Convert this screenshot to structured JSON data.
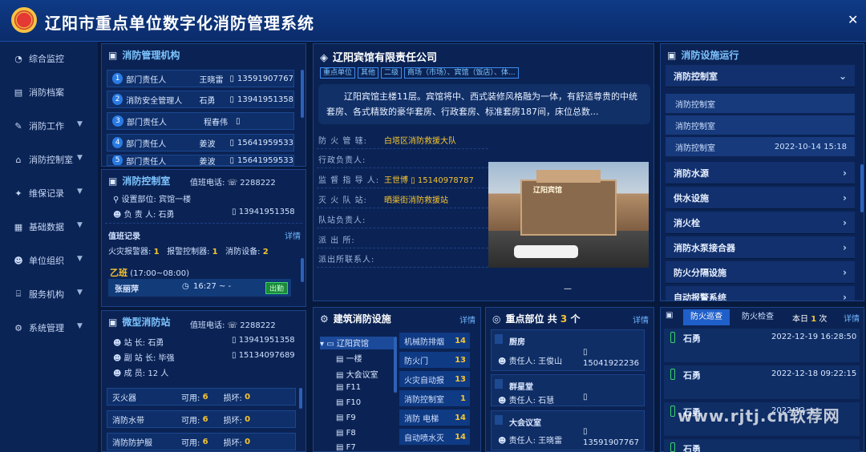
{
  "app": {
    "title": "辽阳市重点单位数字化消防管理系统",
    "close_icon": "close-icon"
  },
  "nav": [
    {
      "label": "综合监控",
      "icon": "dashboard-icon"
    },
    {
      "label": "消防档案",
      "icon": "file-icon"
    },
    {
      "label": "消防工作",
      "icon": "edit-icon"
    },
    {
      "label": "消防控制室",
      "icon": "home-icon"
    },
    {
      "label": "维保记录",
      "icon": "wrench-icon"
    },
    {
      "label": "基础数据",
      "icon": "grid-icon"
    },
    {
      "label": "单位组织",
      "icon": "users-icon"
    },
    {
      "label": "服务机构",
      "icon": "bank-icon"
    },
    {
      "label": "系统管理",
      "icon": "gear-icon"
    }
  ],
  "org": {
    "title": "消防管理机构",
    "rows": [
      {
        "n": "1",
        "role": "部门责任人",
        "name": "王晓雷",
        "phone": "13591907767"
      },
      {
        "n": "2",
        "role": "消防安全管理人",
        "name": "石勇",
        "phone": "13941951358"
      },
      {
        "n": "3",
        "role": "部门责任人",
        "name": "程春伟",
        "phone": ""
      },
      {
        "n": "4",
        "role": "部门责任人",
        "name": "姜波",
        "phone": "15641959533"
      },
      {
        "n": "5",
        "role": "部门责任人",
        "name": "姜波",
        "phone": "15641959533"
      }
    ]
  },
  "control": {
    "title": "消防控制室",
    "duty_label": "值班电话:",
    "duty_phone": "2288222",
    "loc_label": "设置部位:",
    "loc": "宾馆一楼",
    "resp_label": "负 责 人:",
    "resp": "石勇",
    "resp_phone": "13941951358",
    "rec_label": "值班记录",
    "detail": "详情",
    "counts": [
      {
        "label": "火灾报警器:",
        "val": "1"
      },
      {
        "label": "报警控制器:",
        "val": "1"
      },
      {
        "label": "消防设备:",
        "val": "2"
      }
    ],
    "shift": "乙班",
    "shift_time": "(17:00~08:00)",
    "person": "张丽萍",
    "time": "16:27 ~ -",
    "status": "出勤"
  },
  "micro": {
    "title": "微型消防站",
    "duty_label": "值班电话:",
    "duty_phone": "2288222",
    "station_label": "站      长:",
    "station": "石勇",
    "station_phone": "13941951358",
    "vice_label": "副 站 长:",
    "vice": "毕强",
    "vice_phone": "15134097689",
    "member_label": "成      员:",
    "member": "12 人",
    "items": [
      {
        "name": "灭火器",
        "ok_label": "可用:",
        "ok": "6",
        "bad_label": "损坏:",
        "bad": "0"
      },
      {
        "name": "消防水带",
        "ok_label": "可用:",
        "ok": "6",
        "bad_label": "损坏:",
        "bad": "0"
      },
      {
        "name": "消防防护服",
        "ok_label": "可用:",
        "ok": "6",
        "bad_label": "损坏:",
        "bad": "0"
      }
    ]
  },
  "company": {
    "title": "辽阳宾馆有限责任公司",
    "tags": [
      "重点单位",
      "其他",
      "二级",
      "商场（市场）、宾馆（饭店）、体..."
    ],
    "desc": "辽阳宾馆主楼11层。宾馆将中、西式装修风格融为一体，有舒适尊贵的中统套房、各式精致的豪华套房、行政套房、标准套房187间，床位总数...",
    "info": [
      {
        "label": "防 火 管 辖:",
        "val": "白塔区消防救援大队",
        "phone": ""
      },
      {
        "label": "行政负责人:",
        "val": "",
        "phone": ""
      },
      {
        "label": "监 督 指 导 人:",
        "val": "王世博",
        "phone": "15140978787"
      },
      {
        "label": "灭 火 队 站:",
        "val": "晒渠街消防救援站",
        "phone": ""
      },
      {
        "label": "队站负责人:",
        "val": "",
        "phone": ""
      },
      {
        "label": "派      出      所:",
        "val": "",
        "phone": ""
      },
      {
        "label": "派出所联系人:",
        "val": "",
        "phone": ""
      }
    ],
    "photo_label": "辽阳宾馆",
    "pager": "—"
  },
  "facility": {
    "title": "建筑消防设施",
    "detail": "详情",
    "tree": [
      "辽阳宾馆",
      "一楼",
      "大会议室",
      "F11",
      "F10",
      "F9",
      "F8",
      "F7"
    ],
    "items": [
      {
        "name": "机械防排烟",
        "n": "14"
      },
      {
        "name": "防火门",
        "n": "13"
      },
      {
        "name": "火灾自动报",
        "n": "13"
      },
      {
        "name": "消防控制室",
        "n": "1"
      },
      {
        "name": "消防 电梯",
        "n": "14"
      },
      {
        "name": "自动喷水灭",
        "n": "14"
      }
    ]
  },
  "key": {
    "title": "重点部位",
    "count_prefix": "共",
    "count": "3",
    "count_suffix": "个",
    "detail": "详情",
    "items": [
      {
        "name": "厨房",
        "resp_label": "责任人:",
        "resp": "王俊山",
        "phone": "15041922236"
      },
      {
        "name": "群星堂",
        "resp_label": "责任人:",
        "resp": "石慧",
        "phone": ""
      },
      {
        "name": "大会议室",
        "resp_label": "责任人:",
        "resp": "王晓雷",
        "phone": "13591907767"
      }
    ]
  },
  "equip": {
    "title": "消防设施运行",
    "groups": [
      {
        "label": "消防控制室",
        "expanded": true
      },
      {
        "label": "消防水源"
      },
      {
        "label": "供水设施"
      },
      {
        "label": "消火栓"
      },
      {
        "label": "消防水泵接合器"
      },
      {
        "label": "防火分隔设施"
      },
      {
        "label": "自动报警系统"
      }
    ],
    "subs": [
      {
        "label": "消防控制室",
        "time": ""
      },
      {
        "label": "消防控制室",
        "time": ""
      },
      {
        "label": "消防控制室",
        "time": "2022-10-14 15:18"
      }
    ]
  },
  "patrol": {
    "tab1": "防火巡查",
    "tab2": "防火检查",
    "today_prefix": "本日",
    "today_count": "1",
    "today_suffix": "次",
    "detail": "详情",
    "items": [
      {
        "name": "石勇",
        "time": "2022-12-19 16:28:50"
      },
      {
        "name": "石勇",
        "time": "2022-12-18 09:22:15"
      },
      {
        "name": "石勇",
        "time": "2022-12-..."
      },
      {
        "name": "石勇",
        "time": ""
      }
    ]
  },
  "watermark": "www.rjtj.cn软荐网",
  "colors": {
    "accent": "#7cc4ff",
    "highlight": "#f7c531",
    "bg": "#071a3d",
    "panel": "#0b2354"
  }
}
